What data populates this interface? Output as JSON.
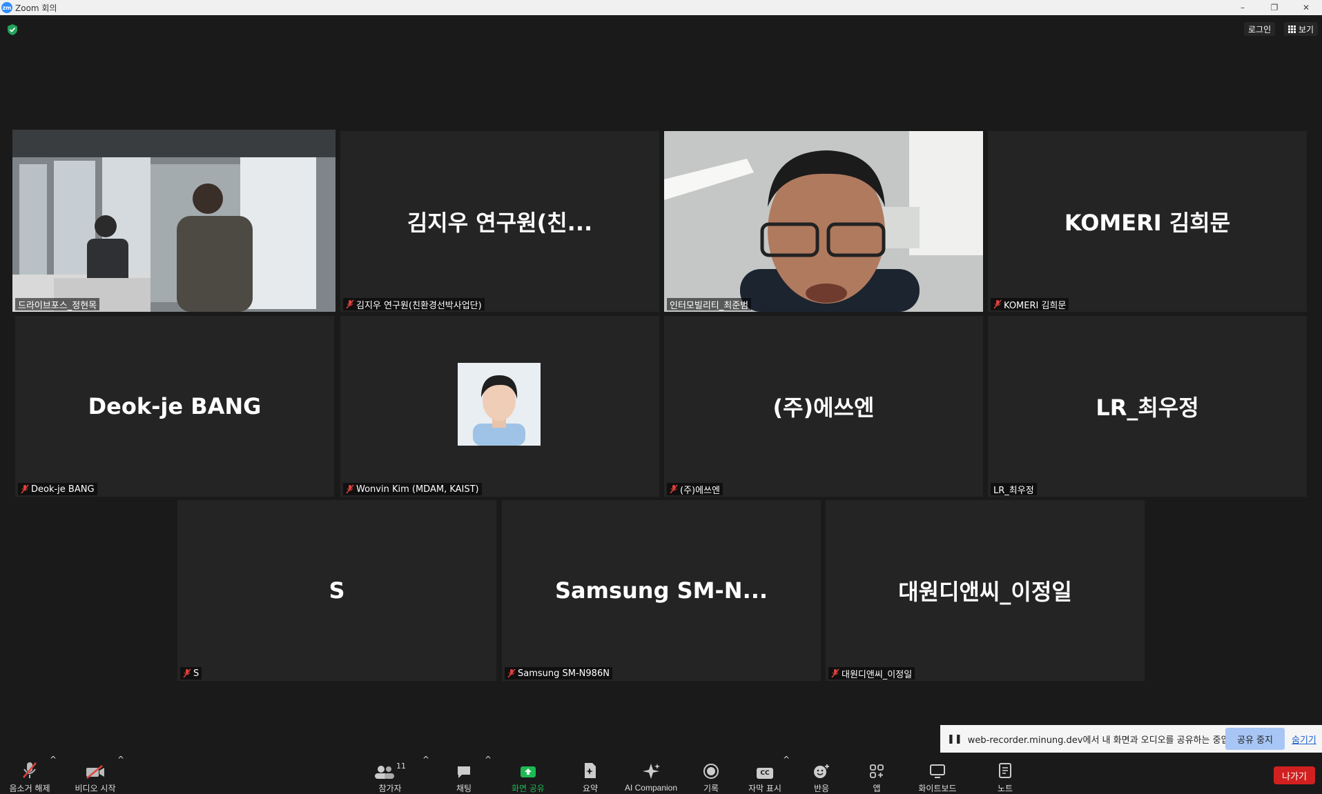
{
  "window": {
    "title": "Zoom 회의",
    "logo_text": "zm"
  },
  "top_right": {
    "login_label": "로그인",
    "view_label": "보기"
  },
  "participants": [
    {
      "display": "",
      "label": "드라이브포스_정현목",
      "muted": false,
      "video": true,
      "active": true
    },
    {
      "display": "김지우 연구원(친...",
      "label": "김지우 연구원(친환경선박사업단)",
      "muted": true
    },
    {
      "display": "",
      "label": "인터모빌리티_최준범",
      "muted": false,
      "video": true
    },
    {
      "display": "KOMERI 김희문",
      "label": "KOMERI 김희문",
      "muted": true
    },
    {
      "display": "Deok-je BANG",
      "label": "Deok-je BANG",
      "muted": true
    },
    {
      "display": "",
      "label": "Wonvin Kim (MDAM, KAIST)",
      "muted": true,
      "photo": true
    },
    {
      "display": "(주)에쓰엔",
      "label": "(주)에쓰엔",
      "muted": true
    },
    {
      "display": "LR_최우정",
      "label": "LR_최우정",
      "muted": false
    },
    {
      "display": "S",
      "label": "S",
      "muted": true
    },
    {
      "display": "Samsung  SM-N...",
      "label": "Samsung SM-N986N",
      "muted": true
    },
    {
      "display": "대원디앤씨_이정일",
      "label": "대원디앤씨_이정일",
      "muted": true
    }
  ],
  "share_bar": {
    "message": "web-recorder.minung.dev에서 내 화면과 오디오를 공유하는 중입니다.",
    "stop_label": "공유 중지",
    "hide_label": "숨기기"
  },
  "toolbar": {
    "unmute": "음소거 해제",
    "start_video": "비디오 시작",
    "participants": "참가자",
    "participants_count": "11",
    "chat": "채팅",
    "share_screen": "화면 공유",
    "summary": "요약",
    "ai_companion": "AI Companion",
    "record": "기록",
    "captions": "자막 표시",
    "captions_icon_text": "CC",
    "reactions": "반응",
    "apps": "앱",
    "whiteboard": "화이트보드",
    "notes": "노트",
    "leave": "나가기"
  },
  "colors": {
    "active_speaker": "#d9e85a",
    "share_green": "#1db954",
    "leave_red": "#d22020",
    "muted_red": "#e0413a"
  }
}
